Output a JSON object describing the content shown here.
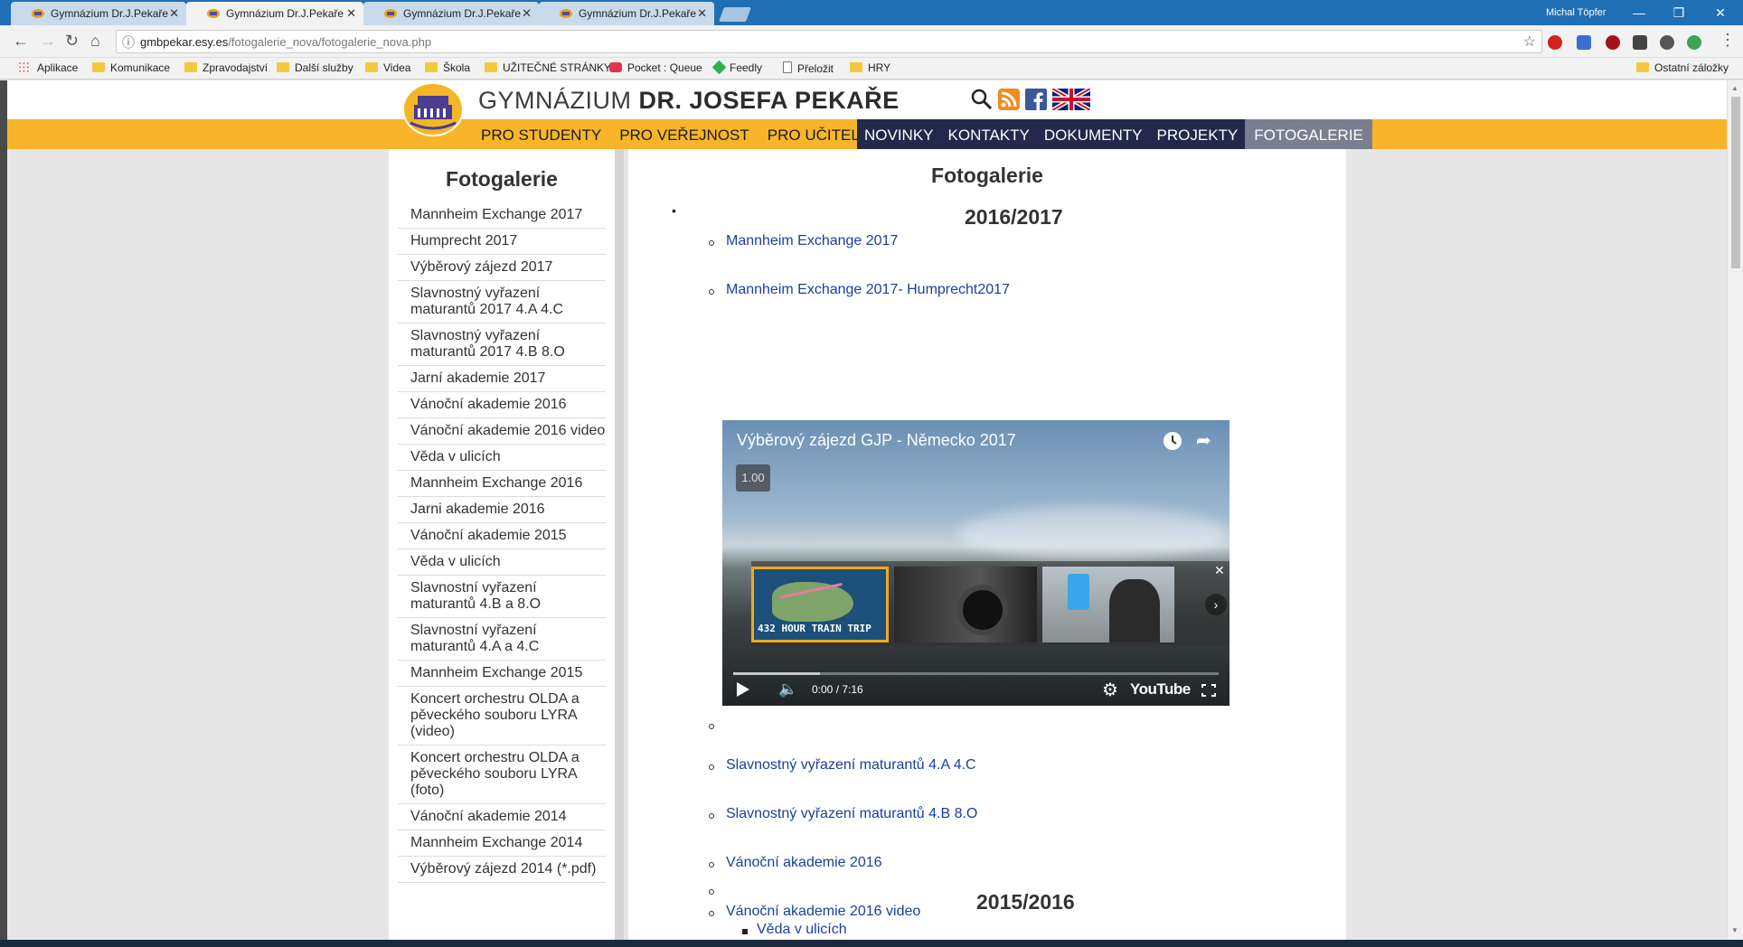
{
  "browser": {
    "tabs": [
      {
        "title": "Gymnázium Dr.J.Pekaře",
        "active": false
      },
      {
        "title": "Gymnázium Dr.J.Pekaře",
        "active": true
      },
      {
        "title": "Gymnázium Dr.J.Pekaře",
        "active": false
      },
      {
        "title": "Gymnázium Dr.J.Pekaře",
        "active": false
      }
    ],
    "user": "Michal Töpfer",
    "url_domain": "gmbpekar.esy.es",
    "url_path": "/fotogalerie_nova/fotogalerie_nova.php",
    "bookmarks": [
      "Aplikace",
      "Komunikace",
      "Zpravodajství",
      "Další služby",
      "Videa",
      "Škola",
      "UŽITEČNÉ STRÁNKY",
      "Pocket : Queue",
      "Feedly",
      "Přeložit",
      "HRY"
    ],
    "other_bookmarks": "Ostatní záložky"
  },
  "site": {
    "name_light": "GYMNÁZIUM",
    "name_bold": "DR. JOSEFA PEKAŘE",
    "menu_left": [
      "PRO STUDENTY",
      "PRO VEŘEJNOST",
      "PRO UČITELE"
    ],
    "menu_dark": [
      "NOVINKY",
      "KONTAKTY",
      "DOKUMENTY",
      "PROJEKTY",
      "FOTOGALERIE"
    ]
  },
  "sidebar": {
    "title": "Fotogalerie",
    "items": [
      "Mannheim Exchange 2017",
      "Humprecht 2017",
      "Výběrový zájezd 2017",
      "Slavnostný vyřazení maturantů 2017 4.A 4.C",
      "Slavnostný vyřazení maturantů 2017 4.B 8.O",
      "Jarní akademie 2017",
      "Vánoční akademie 2016",
      "Vánoční akademie 2016 video",
      "Věda v ulicích",
      "Mannheim Exchange 2016",
      "Jarni akademie 2016",
      "Vánoční akademie 2015",
      "Věda v ulicích",
      "Slavnostní vyřazení maturantů 4.B a 8.O",
      "Slavnostní vyřazení maturantů 4.A a 4.C",
      "Mannheim Exchange 2015",
      "Koncert orchestru OLDA a pěveckého souboru LYRA (video)",
      "Koncert orchestru OLDA a pěveckého souboru LYRA (foto)",
      "Vánoční akademie 2014",
      "Mannheim Exchange 2014",
      "Výběrový zájezd 2014 (*.pdf)"
    ]
  },
  "main": {
    "title": "Fotogalerie",
    "year1": "2016/2017",
    "links1a": [
      "Mannheim Exchange 2017",
      "Mannheim Exchange 2017- Humprecht2017"
    ],
    "links1b": [
      "Slavnostný vyřazení maturantů 4.A 4.C",
      "Slavnostný vyřazení maturantů 4.B 8.O",
      "Vánoční akademie 2016",
      "Vánoční akademie 2016 video"
    ],
    "year2": "2015/2016",
    "links2": [
      "Věda v ulicích"
    ]
  },
  "video": {
    "title": "Výběrový zájezd GJP - Německo 2017",
    "speed": "1.00",
    "endscreen_caption": "432 HOUR TRAIN TRIP",
    "time": "0:00 / 7:16",
    "brand": "YouTube"
  }
}
